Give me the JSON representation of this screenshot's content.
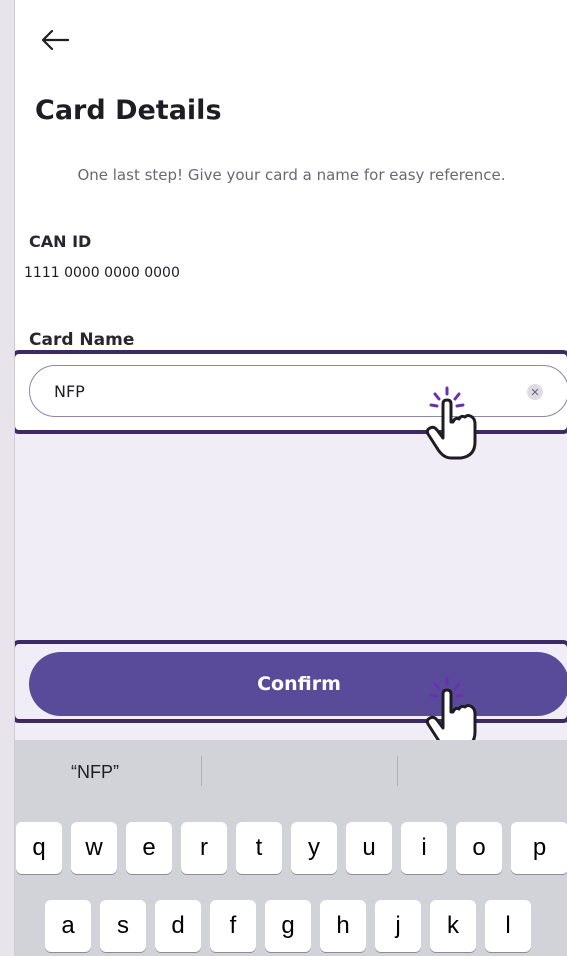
{
  "header": {
    "back_icon": "arrow-left-icon",
    "title": "Card Details"
  },
  "intro": {
    "text": "One last step! Give your card a name for easy reference."
  },
  "can": {
    "label": "CAN ID",
    "value": "1111 0000 0000 0000"
  },
  "card_name": {
    "label": "Card Name",
    "value": "NFP",
    "clear_icon": "clear-x-icon"
  },
  "confirm": {
    "label": "Confirm"
  },
  "keyboard": {
    "suggestion": "“NFP”",
    "row1": [
      "q",
      "w",
      "e",
      "r",
      "t",
      "y",
      "u",
      "i",
      "o",
      "p"
    ],
    "row2": [
      "a",
      "s",
      "d",
      "f",
      "g",
      "h",
      "j",
      "k",
      "l"
    ]
  },
  "colors": {
    "accent": "#5a4b9a",
    "highlight_border": "#3b2a63",
    "tap_icon": "#6a2fb5"
  }
}
